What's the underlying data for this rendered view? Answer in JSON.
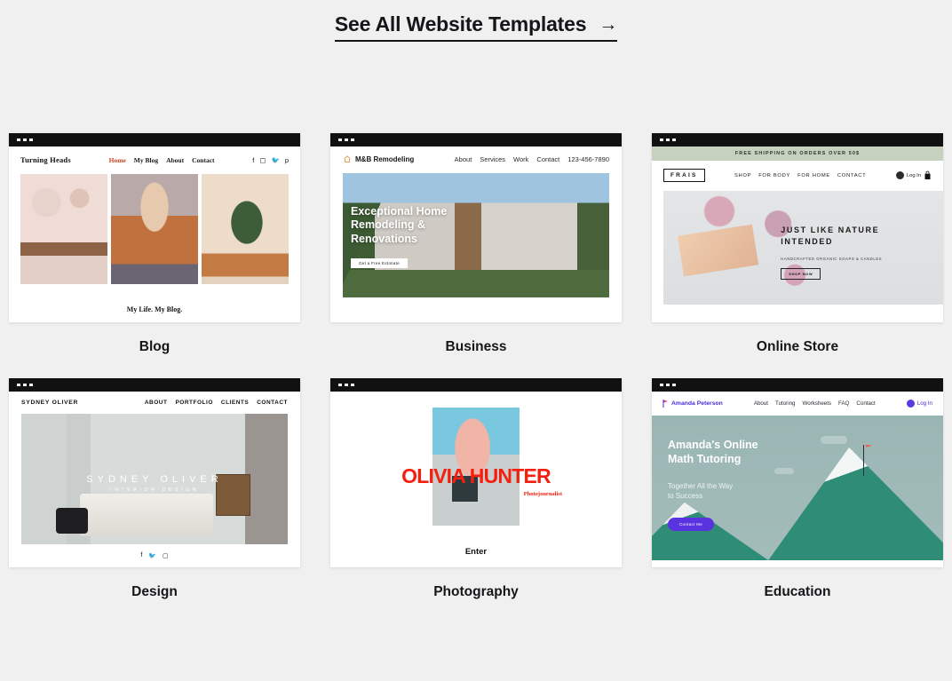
{
  "header": {
    "link_label": "See All Website Templates",
    "arrow": "→"
  },
  "templates": [
    {
      "category": "Blog",
      "site": {
        "logo": "Turning Heads",
        "nav": [
          "Home",
          "My Blog",
          "About",
          "Contact"
        ],
        "active_nav": "Home",
        "active_color": "#d1441f",
        "social": [
          "facebook-icon",
          "instagram-icon",
          "twitter-icon",
          "pinterest-icon"
        ],
        "caption": "My Life. My Blog."
      }
    },
    {
      "category": "Business",
      "site": {
        "logo": "M&B Remodeling",
        "logo_icon": "house-icon",
        "nav": [
          "About",
          "Services",
          "Work",
          "Contact",
          "123-456-7890"
        ],
        "hero_title_line1": "Exceptional Home",
        "hero_title_line2": "Remodeling &",
        "hero_title_line3": "Renovations",
        "hero_button": "Get a Free Estimate"
      }
    },
    {
      "category": "Online Store",
      "site": {
        "banner": "FREE SHIPPING ON ORDERS OVER 50$",
        "banner_color": "#c6d2bf",
        "logo": "FRAIS",
        "nav": [
          "SHOP",
          "FOR BODY",
          "FOR HOME",
          "CONTACT"
        ],
        "account_label": "Log In",
        "account_icon": "user-avatar-icon",
        "cart_icon": "shopping-bag-icon",
        "hero_title_line1": "JUST LIKE NATURE",
        "hero_title_line2": "INTENDED",
        "hero_subtitle": "HANDCRAFTED ORGANIC SOAPS & CANDLES",
        "hero_button": "SHOP NOW"
      }
    },
    {
      "category": "Design",
      "site": {
        "logo": "SYDNEY OLIVER",
        "nav": [
          "ABOUT",
          "PORTFOLIO",
          "CLIENTS",
          "CONTACT"
        ],
        "hero_title": "SYDNEY OLIVER",
        "hero_subtitle": "INTERIOR DESIGN",
        "social": [
          "facebook-icon",
          "twitter-icon",
          "instagram-icon"
        ]
      }
    },
    {
      "category": "Photography",
      "site": {
        "title": "OLIVIA HUNTER",
        "subtitle": "Photojournalist",
        "title_color": "#f51f0f",
        "enter_label": "Enter"
      }
    },
    {
      "category": "Education",
      "site": {
        "logo": "Amanda Peterson",
        "logo_icon": "flag-icon",
        "logo_color": "#4a2ad6",
        "nav": [
          "About",
          "Tutoring",
          "Worksheets",
          "FAQ",
          "Contact"
        ],
        "account_label": "Log In",
        "account_icon": "user-avatar-icon",
        "hero_title_line1": "Amanda's Online",
        "hero_title_line2": "Math Tutoring",
        "hero_sub_line1": "Together All the Way",
        "hero_sub_line2": "to Success",
        "hero_button": "Contact Me",
        "hero_button_color": "#5a33e0"
      }
    }
  ]
}
